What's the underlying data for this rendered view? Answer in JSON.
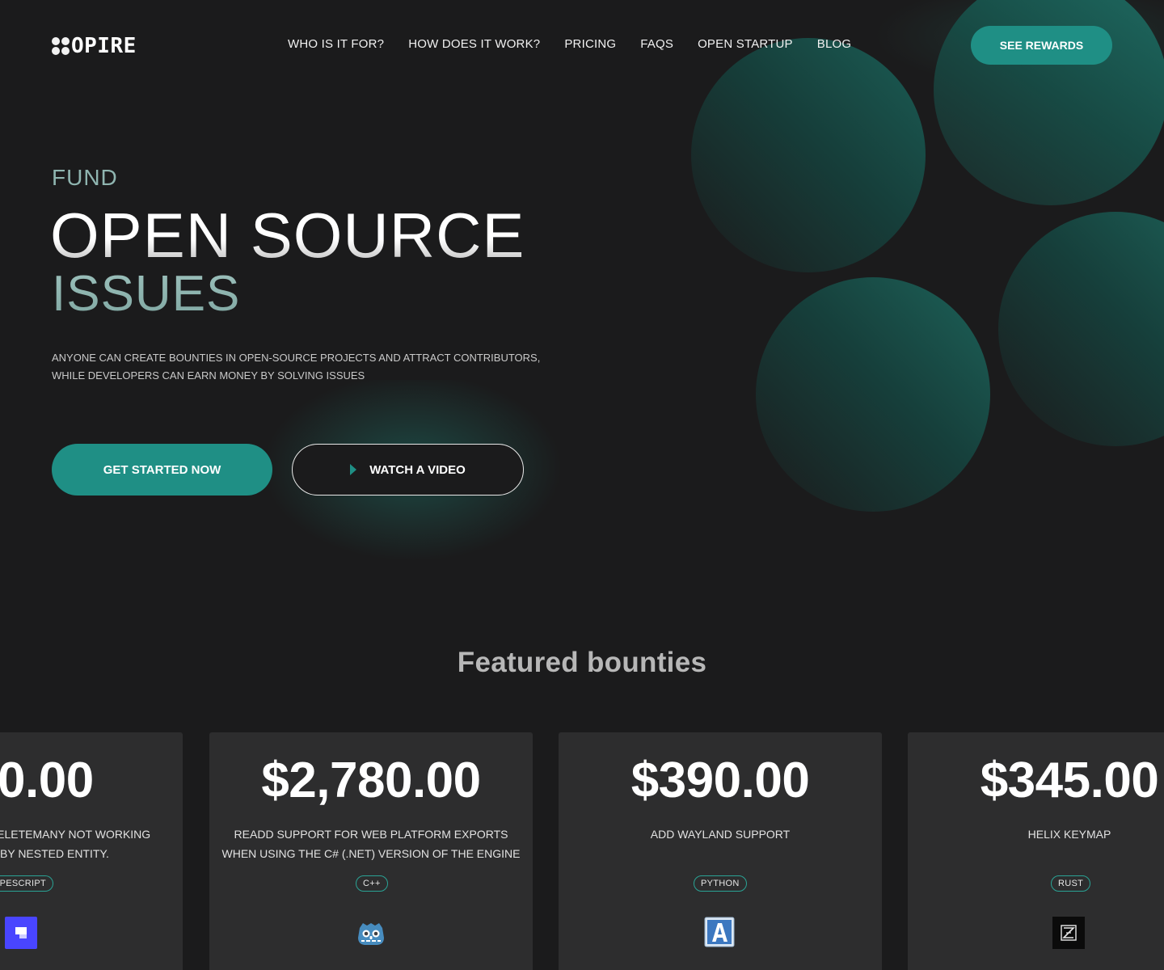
{
  "brand": {
    "name": "OPIRE"
  },
  "nav": {
    "items": [
      {
        "label": "WHO IS IT FOR?"
      },
      {
        "label": "HOW DOES IT WORK?"
      },
      {
        "label": "PRICING"
      },
      {
        "label": "FAQS"
      },
      {
        "label": "OPEN STARTUP"
      },
      {
        "label": "BLOG"
      }
    ],
    "cta": "SEE REWARDS"
  },
  "hero": {
    "kicker": "FUND",
    "title_line1": "OPEN SOURCE",
    "title_line2": "ISSUES",
    "description": "ANYONE CAN CREATE BOUNTIES IN OPEN-SOURCE PROJECTS AND ATTRACT CONTRIBUTORS, WHILE DEVELOPERS CAN EARN MONEY BY SOLVING ISSUES",
    "primary_cta": "GET STARTED NOW",
    "secondary_cta": "WATCH A VIDEO"
  },
  "featured": {
    "title": "Featured bounties",
    "cards": [
      {
        "amount": "0.00",
        "title": "DELETEMANY NOT WORKING R BY NESTED ENTITY.",
        "title_lines": [
          "DELETEMANY NOT WORKING",
          "R BY NESTED ENTITY."
        ],
        "tag": "YPESCRIPT",
        "icon": "strapi-icon"
      },
      {
        "amount": "$2,780.00",
        "title": "READD SUPPORT FOR WEB PLATFORM EXPORTS WHEN USING THE C# (.NET) VERSION OF THE ENGINE",
        "tag": "C++",
        "icon": "godot-icon"
      },
      {
        "amount": "$390.00",
        "title": "ADD WAYLAND SUPPORT",
        "tag": "PYTHON",
        "icon": "letter-a-icon"
      },
      {
        "amount": "$345.00",
        "title": "HELIX KEYMAP",
        "tag": "RUST",
        "icon": "zed-icon"
      }
    ]
  },
  "colors": {
    "background": "#1b1b1c",
    "accent": "#1f8f85",
    "card": "#2d2d2e",
    "muted_teal": "#8fb5b0"
  }
}
